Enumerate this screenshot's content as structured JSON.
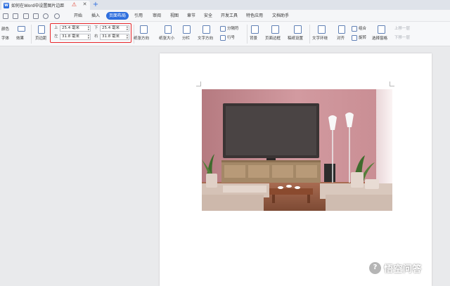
{
  "titlebar": {
    "doc_title": "如何在Word中设置图片边距",
    "doc_icon_letter": "W"
  },
  "menubar": {
    "tabs": [
      {
        "label": "开始",
        "active": false
      },
      {
        "label": "插入",
        "active": false
      },
      {
        "label": "页面布局",
        "active": true
      },
      {
        "label": "引用",
        "active": false
      },
      {
        "label": "审阅",
        "active": false
      },
      {
        "label": "视图",
        "active": false
      },
      {
        "label": "章节",
        "active": false
      },
      {
        "label": "安全",
        "active": false
      },
      {
        "label": "开发工具",
        "active": false
      },
      {
        "label": "特色应用",
        "active": false
      },
      {
        "label": "文档助手",
        "active": false
      }
    ]
  },
  "ribbon": {
    "theme_color": "颜色",
    "theme_font": "字体",
    "theme_effect": "效果",
    "page_margin": "页边距",
    "margins": {
      "top_label": "上",
      "top_value": "25.4 毫米",
      "bottom_label": "下",
      "bottom_value": "25.4 毫米",
      "left_label": "左",
      "left_value": "31.8 毫米",
      "right_label": "右",
      "right_value": "31.8 毫米"
    },
    "orientation": "纸张方向",
    "paper_size": "纸张大小",
    "columns": "分栏",
    "text_direction": "文字方向",
    "separator": "分隔符",
    "line_number": "行号",
    "background": "背景",
    "page_border": "页面边框",
    "draft_setting": "稿纸设置",
    "text_wrap": "文字环绕",
    "align": "对齐",
    "group": "组合",
    "rotate": "旋转",
    "selection_pane": "选择窗格",
    "bring_forward": "上移一层",
    "send_backward": "下移一层"
  },
  "watermark": {
    "logo_glyph": "?",
    "text": "悟空问答"
  },
  "colors": {
    "accent": "#2f6fde",
    "highlight": "#e8282b",
    "wall_pink": "#c98f93"
  }
}
